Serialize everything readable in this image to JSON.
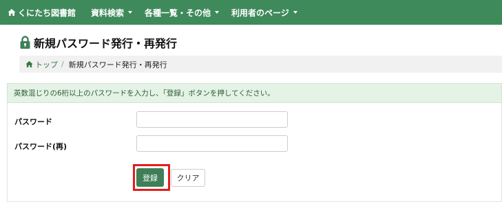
{
  "navbar": {
    "home_label": "くにたち図書館",
    "menus": [
      "資料検索",
      "各種一覧・その他",
      "利用者のページ"
    ]
  },
  "page": {
    "title": "新規パスワード発行・再発行"
  },
  "breadcrumb": {
    "home_label": "トップ",
    "separator": "/",
    "current": "新規パスワード発行・再発行"
  },
  "alert": {
    "message": "英数混じりの6桁以上のパスワードを入力し、「登録」ボタンを押してください。"
  },
  "form": {
    "password_label": "パスワード",
    "password_confirm_label": "パスワード(再)",
    "password_value": "",
    "password_confirm_value": "",
    "register_button": "登録",
    "clear_button": "クリア"
  },
  "colors": {
    "navbar": "#3e8a5b",
    "register_button": "#3e7f57",
    "highlight": "#e31b1b",
    "alert_bg": "#e4f3e6"
  }
}
